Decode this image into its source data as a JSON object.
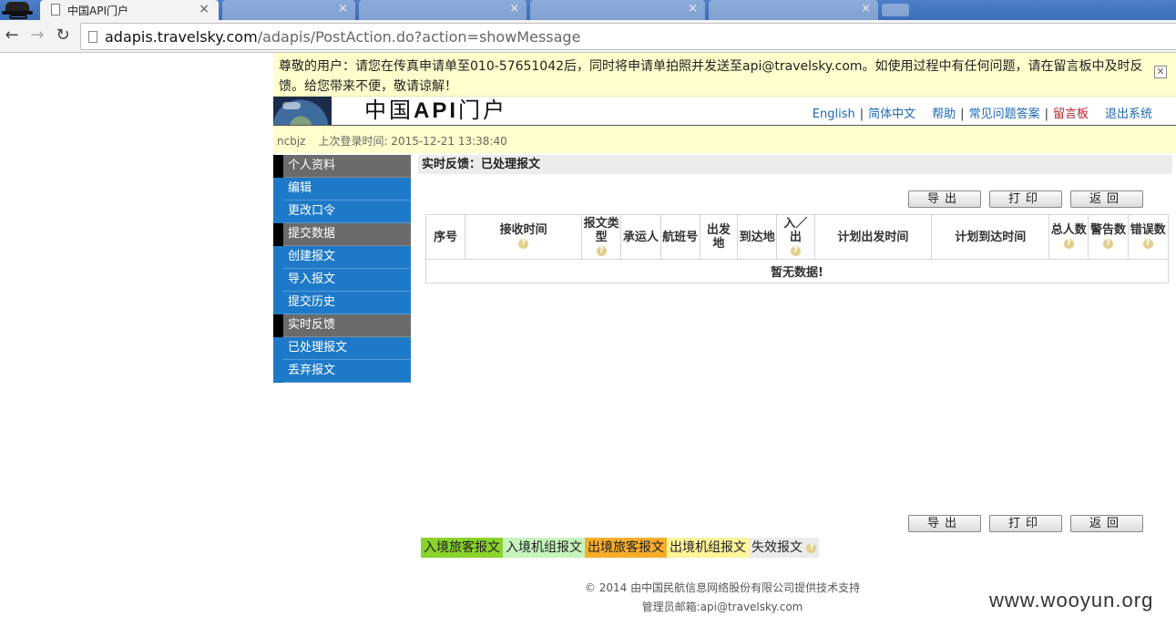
{
  "browser": {
    "active_tab_title": "中国API门户",
    "url_host": "adapis.travelsky.com",
    "url_path": "/adapis/PostAction.do?action=showMessage"
  },
  "notice": {
    "text": "尊敬的用户：请您在传真申请单至010-57651042后，同时将申请单拍照并发送至api@travelsky.com。如使用过程中有任何问题，请在留言板中及时反馈。给您带来不便，敬请谅解！",
    "close": "✕"
  },
  "header": {
    "title_prefix": "中国",
    "title_api": "API",
    "title_suffix": "门户",
    "links": {
      "english": "English",
      "chinese": "简体中文",
      "help": "帮助",
      "faq": "常见问题答案",
      "message_board": "留言板",
      "logout": "退出系统"
    },
    "link_color_board": "#b5232a"
  },
  "userbar": {
    "username": "ncbjz",
    "last_login": "上次登录时间: 2015-12-21 13:38:40"
  },
  "sidebar": {
    "items": [
      {
        "label": "个人资料",
        "type": "header"
      },
      {
        "label": "编辑",
        "type": "link"
      },
      {
        "label": "更改口令",
        "type": "link"
      },
      {
        "label": "提交数据",
        "type": "header"
      },
      {
        "label": "创建报文",
        "type": "link"
      },
      {
        "label": "导入报文",
        "type": "link"
      },
      {
        "label": "提交历史",
        "type": "link"
      },
      {
        "label": "实时反馈",
        "type": "header"
      },
      {
        "label": "已处理报文",
        "type": "link"
      },
      {
        "label": "丢弃报文",
        "type": "link"
      }
    ]
  },
  "main": {
    "title": "实时反馈：已处理报文",
    "buttons": {
      "export": "导出",
      "print": "打印",
      "back": "返回"
    },
    "columns": [
      "序号",
      "接收时间",
      "报文类型",
      "承运人",
      "航班号",
      "出发地",
      "到达地",
      "入／出",
      "计划出发时间",
      "计划到达时间",
      "总人数",
      "警告数",
      "错误数"
    ],
    "empty_message": "暂无数据!"
  },
  "legend": {
    "items": [
      {
        "label": "入境旅客报文",
        "color": "#8ad32c"
      },
      {
        "label": "入境机组报文",
        "color": "#c7f4bd"
      },
      {
        "label": "出境旅客报文",
        "color": "#f7ad2c"
      },
      {
        "label": "出境机组报文",
        "color": "#fff59a"
      },
      {
        "label": "失效报文",
        "color": "#ececec"
      }
    ]
  },
  "footer": {
    "copyright": "© 2014 由中国民航信息网络股份有限公司提供技术支持",
    "admin_email": "管理员邮箱:api@travelsky.com"
  },
  "watermark": "www.wooyun.org",
  "icons": {
    "help": "question-icon",
    "close": "close-icon"
  }
}
